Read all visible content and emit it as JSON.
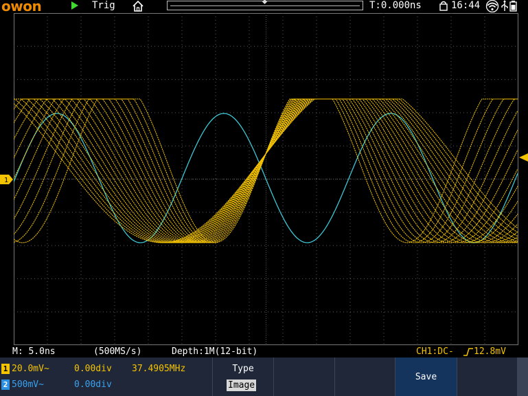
{
  "header": {
    "brand": "owon",
    "run_icon": "play-icon",
    "trigger_status": "Trig",
    "home_icon": "home-icon",
    "trigger_delay": "T:0.000ns",
    "clock_icon": "lock-icon",
    "time": "16:44",
    "wifi_icon": "wifi-icon",
    "usb_icon": "usb-icon",
    "battery_icon": "battery-icon"
  },
  "waveform": {
    "ch1_color": "#f5c400",
    "ch2_color": "#3cc7d6",
    "grid_color": "#5a5a5a",
    "ch1_marker": "1"
  },
  "info": {
    "timebase": "M: 5.0ns",
    "sample_rate": "(500MS/s)",
    "depth": "Depth:1M(12-bit)",
    "trigger": "CH1:DC-",
    "trigger_level": "12.8mV"
  },
  "channels": [
    {
      "badge": "1",
      "color": "#f5c400",
      "scale": "20.0mV~",
      "offset": "0.00div",
      "freq": "37.4905MHz"
    },
    {
      "badge": "2",
      "color": "#2f8fe0",
      "scale": "500mV~",
      "offset": "0.00div",
      "freq": ""
    }
  ],
  "menu": {
    "type_label": "Type",
    "type_value": "Image",
    "save_label": "Save"
  }
}
